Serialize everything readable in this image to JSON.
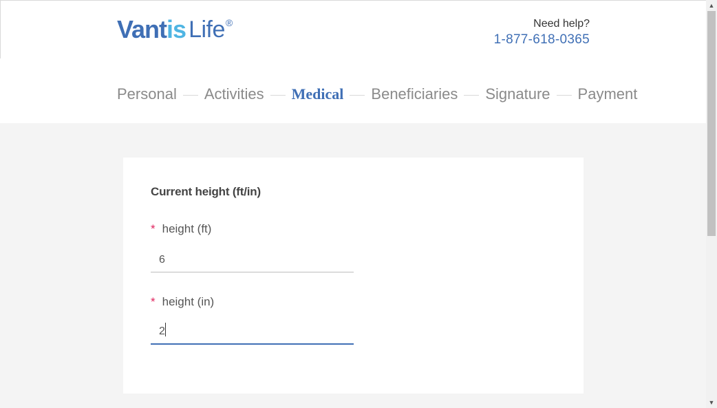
{
  "header": {
    "logo": {
      "part1": "Vant",
      "part2": "is",
      "part3": "Life",
      "reg": "®"
    },
    "help_label": "Need help?",
    "help_phone": "1-877-618-0365"
  },
  "steps": [
    {
      "label": "Personal",
      "active": false
    },
    {
      "label": "Activities",
      "active": false
    },
    {
      "label": "Medical",
      "active": true
    },
    {
      "label": "Beneficiaries",
      "active": false
    },
    {
      "label": "Signature",
      "active": false
    },
    {
      "label": "Payment",
      "active": false
    }
  ],
  "form": {
    "title": "Current height (ft/in)",
    "required_mark": "*",
    "height_ft": {
      "label": "height (ft)",
      "value": "6"
    },
    "height_in": {
      "label": "height (in)",
      "value": "2"
    }
  },
  "colors": {
    "brand_blue": "#3f6fb5",
    "brand_light_blue": "#4fb5e3",
    "required_red": "#e0245e"
  },
  "scrollbar": {
    "up_icon": "▲",
    "down_icon": "▼"
  }
}
